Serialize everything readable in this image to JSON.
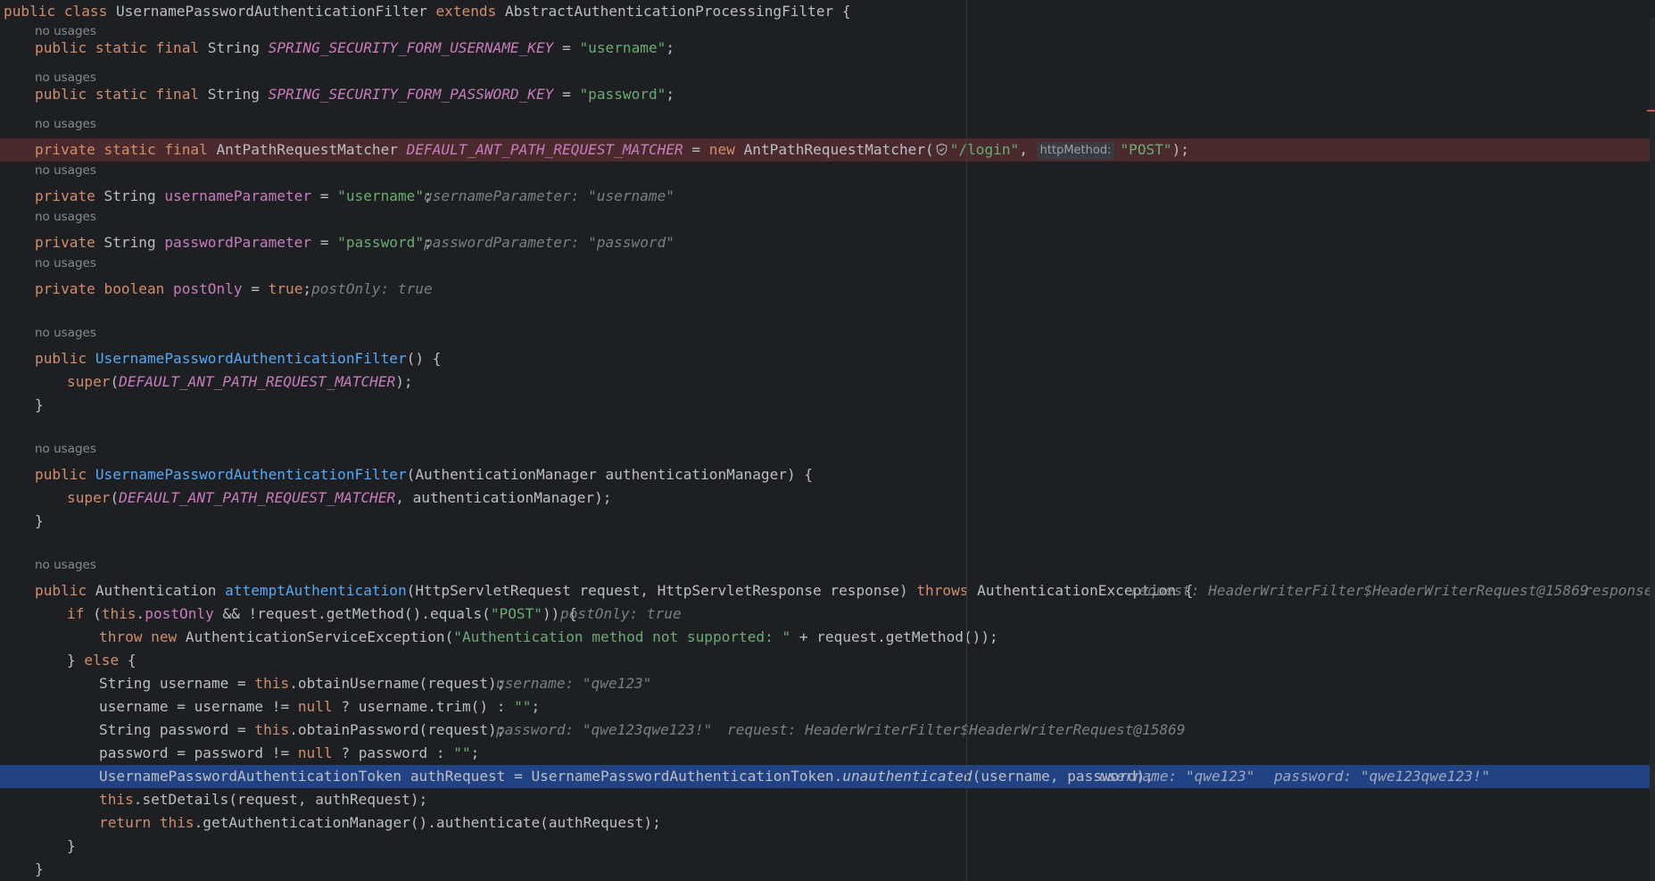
{
  "no_usages_label": "no usages",
  "code": {
    "l_class": {
      "kw1": "public class ",
      "name": "UsernamePasswordAuthenticationFilter",
      "kw2": " extends ",
      "base": "AbstractAuthenticationProcessingFilter {"
    },
    "l_ukey": {
      "kw": "public static final ",
      "type": "String ",
      "name": "SPRING_SECURITY_FORM_USERNAME_KEY",
      "eq": " = ",
      "val": "\"username\"",
      "end": ";"
    },
    "l_pkey": {
      "kw": "public static final ",
      "type": "String ",
      "name": "SPRING_SECURITY_FORM_PASSWORD_KEY",
      "eq": " = ",
      "val": "\"password\"",
      "end": ";"
    },
    "l_matcher": {
      "kw": "private static final ",
      "type": "AntPathRequestMatcher ",
      "name": "DEFAULT_ANT_PATH_REQUEST_MATCHER",
      "eq": " = ",
      "kw2": "new ",
      "ctor": "AntPathRequestMatcher(",
      "arg1": "\"/login\"",
      "sep": ", ",
      "hint": "httpMethod:",
      "arg2": "\"POST\"",
      "end": ");"
    },
    "l_uparam": {
      "kw": "private ",
      "type": "String ",
      "name": "usernameParameter",
      "eq": " = ",
      "val": "\"username\"",
      "end": ";",
      "inlay": "usernameParameter: \"username\""
    },
    "l_pparam": {
      "kw": "private ",
      "type": "String ",
      "name": "passwordParameter",
      "eq": " = ",
      "val": "\"password\"",
      "end": ";",
      "inlay": "passwordParameter: \"password\""
    },
    "l_postonly": {
      "kw": "private boolean ",
      "name": "postOnly",
      "eq": " = ",
      "val": "true",
      "end": ";",
      "inlay": "postOnly: true"
    },
    "l_ctor1": {
      "kw": "public ",
      "name": "UsernamePasswordAuthenticationFilter",
      "rest": "() {"
    },
    "l_super1": {
      "kw": "super",
      "p": "(",
      "const": "DEFAULT_ANT_PATH_REQUEST_MATCHER",
      "end": ");"
    },
    "l_close1": "}",
    "l_ctor2": {
      "kw": "public ",
      "name": "UsernamePasswordAuthenticationFilter",
      "rest": "(AuthenticationManager authenticationManager) {"
    },
    "l_super2": {
      "kw": "super",
      "p": "(",
      "const": "DEFAULT_ANT_PATH_REQUEST_MATCHER",
      "end": ", authenticationManager);"
    },
    "l_close2": "}",
    "l_attempt": {
      "kw": "public ",
      "type": "Authentication ",
      "name": "attemptAuthentication",
      "params": "(HttpServletRequest request, HttpServletResponse response) ",
      "kw2": "throws ",
      "exc": "AuthenticationException {",
      "inlay1": "request: HeaderWriterFilter$HeaderWriterRequest@15869",
      "inlay2": "response:"
    },
    "l_if": {
      "kw": "if ",
      "p1": "(",
      "kw2": "this",
      "dot": ".",
      "field": "postOnly",
      "mid": " && !request.getMethod().equals(",
      "str": "\"POST\"",
      "end": ")) {",
      "inlay": "postOnly: true"
    },
    "l_throw": {
      "kw": "throw new ",
      "rest": "AuthenticationServiceException(",
      "str": "\"Authentication method not supported: \"",
      "end": " + request.getMethod());"
    },
    "l_else": {
      "pre": "} ",
      "kw": "else",
      "end": " {"
    },
    "l_uname": {
      "pre": "String username = ",
      "kw": "this",
      "end": ".obtainUsername(request);",
      "inlay": "username: \"qwe123\""
    },
    "l_utrim": {
      "pre": "username = username != ",
      "kw": "null",
      "mid": " ? username.trim() : ",
      "str": "\"\"",
      "end": ";"
    },
    "l_pword": {
      "pre": "String password = ",
      "kw": "this",
      "end": ".obtainPassword(request);",
      "inlay1": "password: \"qwe123qwe123!\"",
      "inlay2": "request: HeaderWriterFilter$HeaderWriterRequest@15869"
    },
    "l_ptern": {
      "pre": "password = password != ",
      "kw": "null",
      "mid": " ? password : ",
      "str": "\"\"",
      "end": ";"
    },
    "l_token": {
      "pre": "UsernamePasswordAuthenticationToken authRequest = UsernamePasswordAuthenticationToken.",
      "method": "unauthenticated",
      "end": "(username, password);",
      "inlay1": "username: \"qwe123\"",
      "inlay2": "password: \"qwe123qwe123!\""
    },
    "l_details": {
      "kw": "this",
      "end": ".setDetails(request, authRequest);"
    },
    "l_return": {
      "kw": "return ",
      "kw2": "this",
      "end": ".getAuthenticationManager().authenticate(authRequest);"
    },
    "l_close3": "}",
    "l_close4": "}"
  },
  "colors": {
    "background": "#1e1f22",
    "error_line": "#4b2a2d",
    "execution_line": "#214283",
    "keyword": "#cf8e6d",
    "string": "#6aab73",
    "field": "#c77dbb",
    "method_decl": "#56a8f5",
    "inlay": "#7a7e85"
  },
  "icons": {
    "shield": "shield-check-icon"
  }
}
